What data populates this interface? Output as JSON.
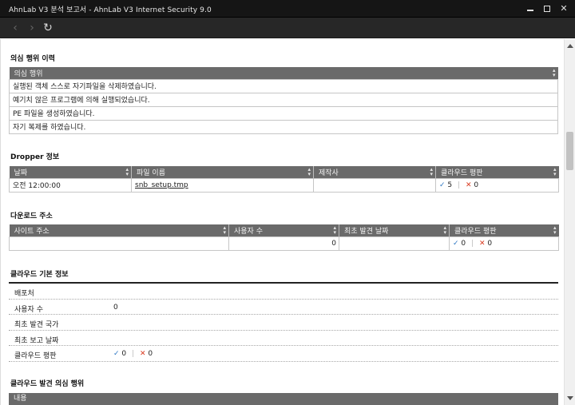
{
  "window": {
    "title": "AhnLab V3 분석 보고서 - AhnLab V3 Internet Security 9.0"
  },
  "suspicious": {
    "title": "의심 행위 이력",
    "header": "의심 행위",
    "rows": [
      "실행된 객체 스스로 자기파일을 삭제하였습니다.",
      "예기치 않은 프로그램에 의해 실행되었습니다.",
      "PE 파일을 생성하였습니다.",
      "자기 복제를 하였습니다."
    ]
  },
  "dropper": {
    "title": "Dropper 정보",
    "headers": [
      "날짜",
      "파일 이름",
      "제작사",
      "클라우드 평판"
    ],
    "row": {
      "date": "오전 12:00:00",
      "file": "snb_setup.tmp",
      "maker": "",
      "good": "5",
      "bad": "0"
    }
  },
  "download": {
    "title": "다운로드 주소",
    "headers": [
      "사이트 주소",
      "사용자 수",
      "최초 발견 날짜",
      "클라우드 평판"
    ],
    "row": {
      "site": "",
      "users": "0",
      "first": "",
      "good": "0",
      "bad": "0"
    }
  },
  "cloud_basic": {
    "title": "클라우드 기본 정보",
    "rows": [
      {
        "key": "배포처",
        "value": ""
      },
      {
        "key": "사용자 수",
        "value": "0"
      },
      {
        "key": "최초 발견 국가",
        "value": ""
      },
      {
        "key": "최초 보고 날짜",
        "value": ""
      },
      {
        "key": "클라우드 평판",
        "good": "0",
        "bad": "0"
      }
    ]
  },
  "cloud_behavior": {
    "title": "클라우드 발견 의심 행위",
    "header": "내용"
  },
  "marks": {
    "check": "✓",
    "cross": "✕",
    "divider": "|",
    "sort": "▲▼"
  },
  "colors": {
    "titlebar": "#151515",
    "navbar": "#272727",
    "table_header": "#6a6a6a",
    "check": "#2f78c4",
    "cross": "#d9381e"
  }
}
